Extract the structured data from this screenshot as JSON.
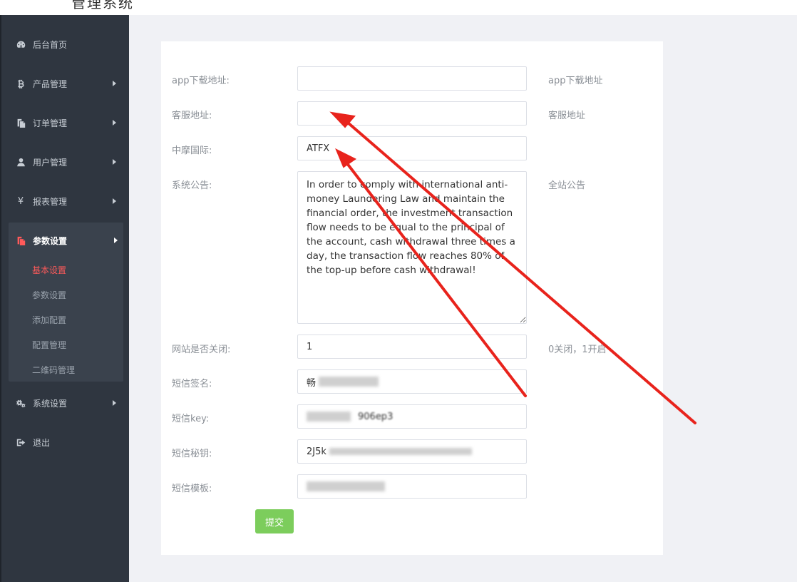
{
  "header": {
    "title": "管理系统"
  },
  "sidebar": {
    "items": [
      {
        "label": "后台首页",
        "icon": "dashboard-icon"
      },
      {
        "label": "产品管理",
        "icon": "bitcoin-icon"
      },
      {
        "label": "订单管理",
        "icon": "copy-icon"
      },
      {
        "label": "用户管理",
        "icon": "user-icon"
      },
      {
        "label": "报表管理",
        "icon": "yen-icon"
      },
      {
        "label": "参数设置",
        "icon": "copy-icon",
        "expanded": true
      },
      {
        "label": "系统设置",
        "icon": "gears-icon"
      },
      {
        "label": "退出",
        "icon": "sign-out-icon"
      }
    ],
    "sub_items": [
      {
        "label": "基本设置",
        "active": true
      },
      {
        "label": "参数设置"
      },
      {
        "label": "添加配置"
      },
      {
        "label": "配置管理"
      },
      {
        "label": "二维码管理"
      }
    ],
    "active_color": "#ff5a5a"
  },
  "form": {
    "fields": [
      {
        "label": "app下载地址:",
        "value": "",
        "hint": "app下载地址"
      },
      {
        "label": "客服地址:",
        "value": "",
        "hint": "客服地址"
      },
      {
        "label": "中摩国际:",
        "value": "ATFX",
        "hint": ""
      },
      {
        "label": "系统公告:",
        "value": "In order to comply with international anti-money Laundering Law and maintain the financial order, the investment transaction flow needs to be equal to the principal of the account, cash withdrawal three times a day, the transaction flow reaches 80% of the top-up before cash withdrawal!",
        "hint": "全站公告"
      },
      {
        "label": "网站是否关闭:",
        "value": "1",
        "hint": "0关闭，1开启"
      },
      {
        "label": "短信签名:",
        "value": "畅",
        "hint": ""
      },
      {
        "label": "短信key:",
        "value": "906ep3",
        "hint": ""
      },
      {
        "label": "短信秘钥:",
        "value": "2J5k",
        "hint": ""
      },
      {
        "label": "短信模板:",
        "value": "",
        "hint": ""
      }
    ],
    "submit_label": "提交"
  },
  "colors": {
    "sidebar_bg": "#2f3640",
    "submit_bg": "#7ccd5c",
    "annotation_arrow": "#e8231c"
  }
}
